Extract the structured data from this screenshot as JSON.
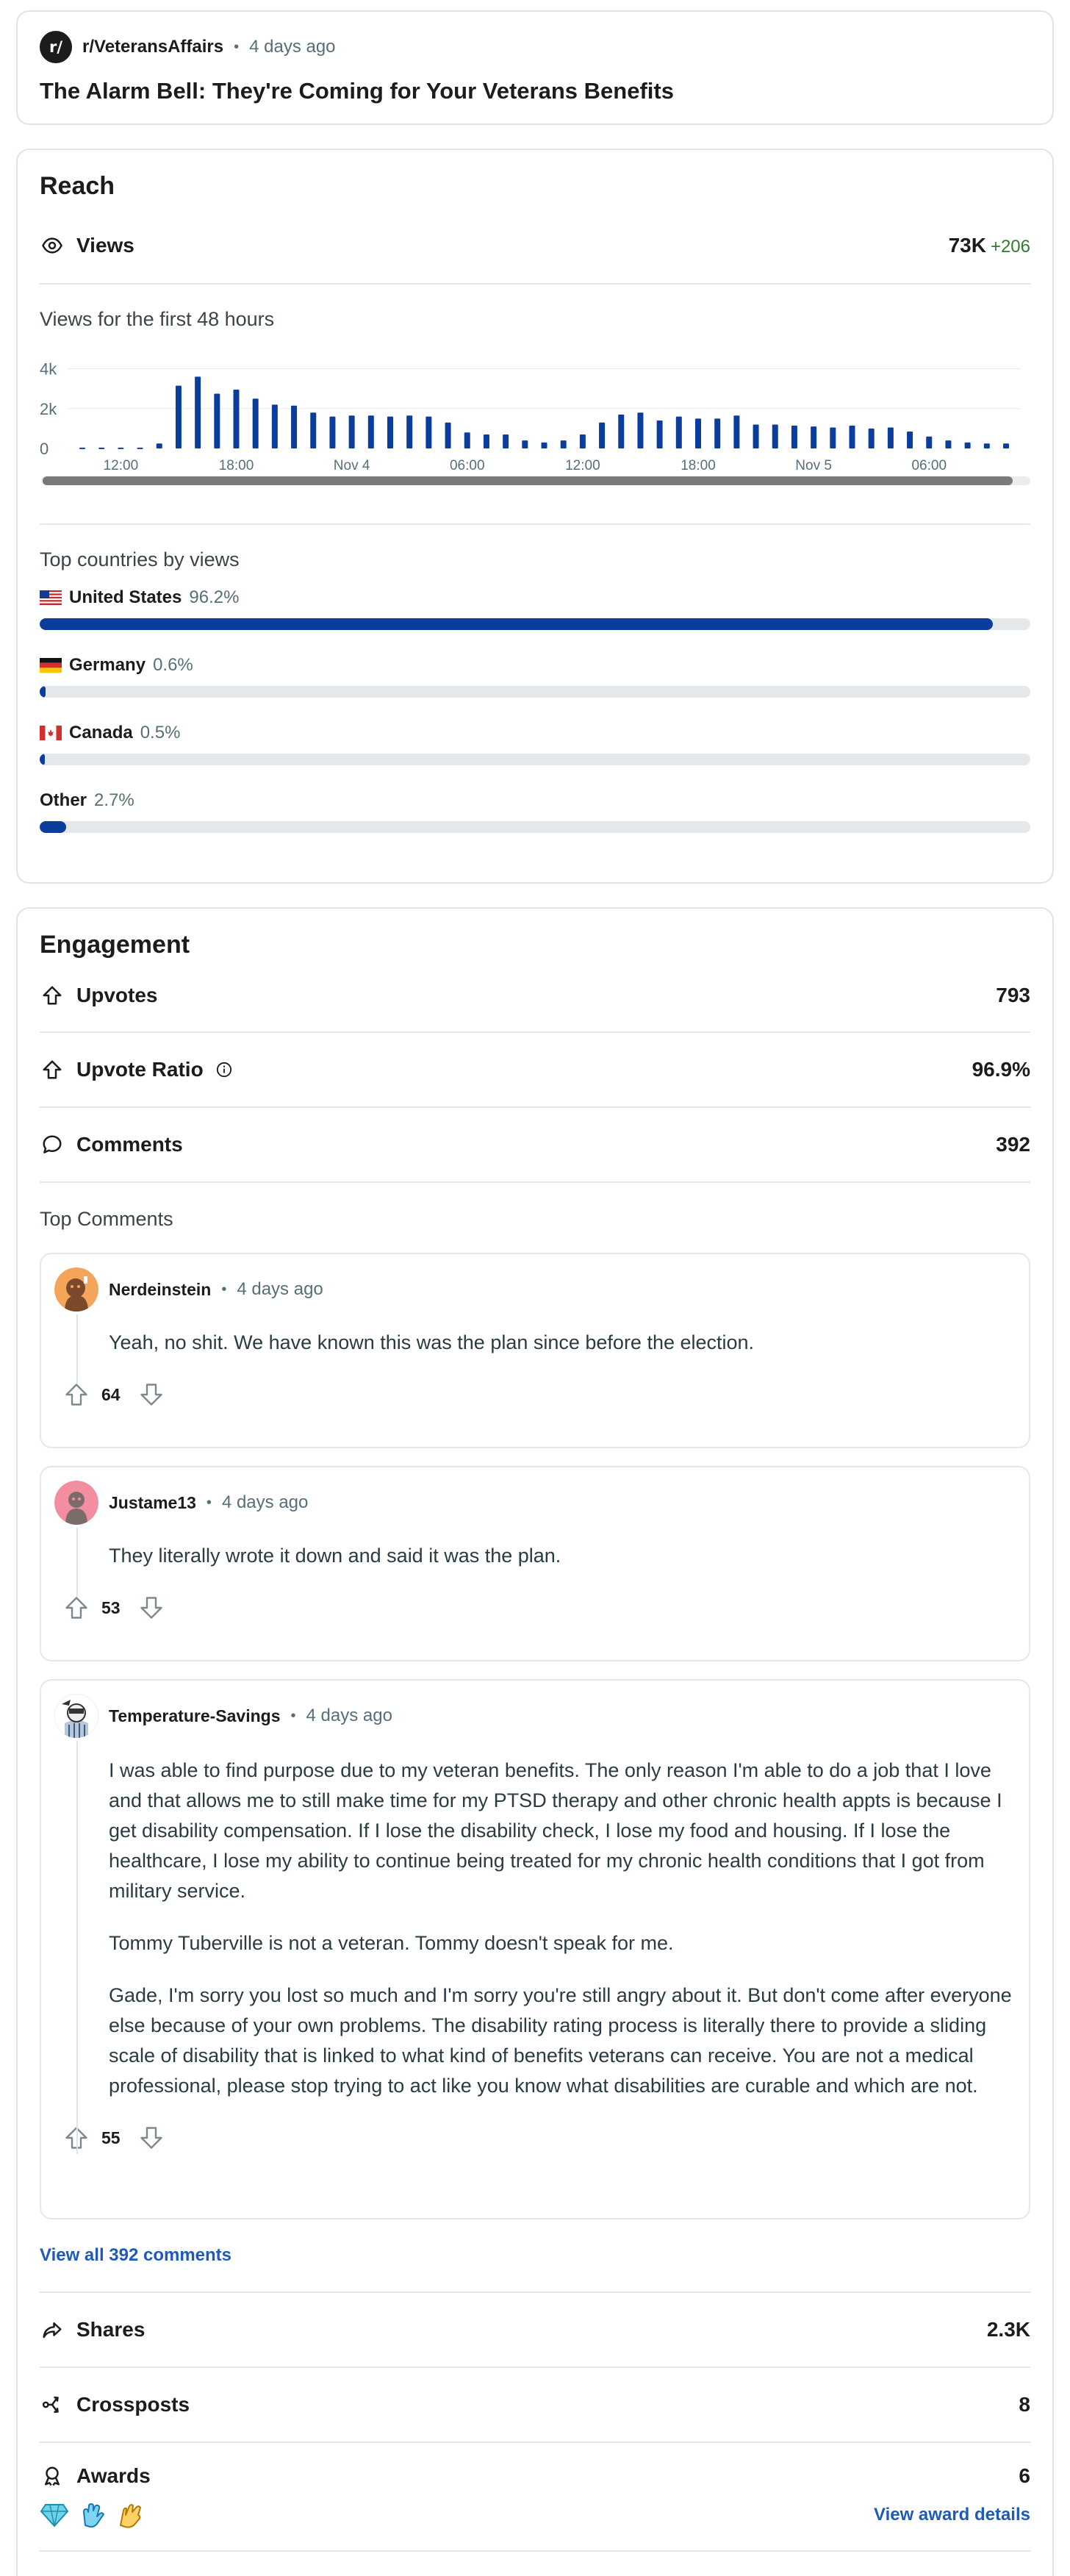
{
  "post": {
    "subreddit": "r/VeteransAffairs",
    "time_ago": "4 days ago",
    "title": "The Alarm Bell: They're Coming for Your Veterans Benefits",
    "avatar_text": "r/"
  },
  "reach": {
    "title": "Reach",
    "views_label": "Views",
    "views_value": "73K",
    "views_delta": "+206",
    "chart_heading": "Views for the first 48 hours",
    "countries_heading": "Top countries by views",
    "countries": [
      {
        "name": "United States",
        "pct": "96.2%",
        "fraction": 0.962
      },
      {
        "name": "Germany",
        "pct": "0.6%",
        "fraction": 0.006
      },
      {
        "name": "Canada",
        "pct": "0.5%",
        "fraction": 0.005
      },
      {
        "name": "Other",
        "pct": "2.7%",
        "fraction": 0.027
      }
    ]
  },
  "chart_data": {
    "type": "bar",
    "title": "Views for the first 48 hours",
    "xlabel": "",
    "ylabel": "",
    "ylim": [
      0,
      4500
    ],
    "y_ticks": [
      "0",
      "2k",
      "4k"
    ],
    "y_tick_values": [
      0,
      2000,
      4000
    ],
    "x_tick_labels": [
      "12:00",
      "18:00",
      "Nov 4",
      "06:00",
      "12:00",
      "18:00",
      "Nov 5",
      "06:00"
    ],
    "x_tick_bar_index": [
      2,
      8,
      14,
      20,
      26,
      32,
      38,
      44
    ],
    "grid": true,
    "bar_color": "#0b3e9c",
    "values": [
      40,
      40,
      40,
      40,
      250,
      3150,
      3600,
      2750,
      2950,
      2500,
      2200,
      2150,
      1800,
      1600,
      1650,
      1650,
      1600,
      1650,
      1600,
      1300,
      800,
      700,
      700,
      400,
      300,
      400,
      700,
      1300,
      1700,
      1800,
      1400,
      1600,
      1500,
      1500,
      1650,
      1200,
      1200,
      1150,
      1100,
      1050,
      1150,
      1000,
      1050,
      850,
      600,
      400,
      300,
      250,
      250
    ]
  },
  "engagement": {
    "title": "Engagement",
    "upvotes_label": "Upvotes",
    "upvotes_value": "793",
    "ratio_label": "Upvote Ratio",
    "ratio_value": "96.9%",
    "comments_label": "Comments",
    "comments_value": "392",
    "top_comments_heading": "Top Comments",
    "view_all": "View all 392 comments",
    "shares_label": "Shares",
    "shares_value": "2.3K",
    "crossposts_label": "Crossposts",
    "crossposts_value": "8",
    "awards_label": "Awards",
    "awards_value": "6",
    "award_details": "View award details"
  },
  "comments": [
    {
      "user": "Nerdeinstein",
      "time_ago": "4 days ago",
      "paragraphs": [
        "Yeah, no shit. We have known this was the plan since before the election."
      ],
      "score": "64"
    },
    {
      "user": "Justame13",
      "time_ago": "4 days ago",
      "paragraphs": [
        "They literally wrote it down and said it was the plan."
      ],
      "score": "53"
    },
    {
      "user": "Temperature-Savings",
      "time_ago": "4 days ago",
      "paragraphs": [
        "I was able to find purpose due to my veteran benefits. The only reason I'm able to do a job that I love and that allows me to still make time for my PTSD therapy and other chronic health appts is because I get disability compensation. If I lose the disability check, I lose my food and housing. If I lose the healthcare, I lose my ability to continue being treated for my chronic health conditions that I got from military service.",
        "Tommy Tuberville is not a veteran. Tommy doesn't speak for me.",
        "Gade, I'm sorry you lost so much and I'm sorry you're still angry about it. But don't come after everyone else because of your own problems. The disability rating process is literally there to provide a sliding scale of disability that is linked to what kind of benefits veterans can receive. You are not a medical professional, please stop trying to act like you know what disabilities are curable and which are not."
      ],
      "score": "55"
    }
  ],
  "icons": {
    "views": "eye-icon",
    "upvotes": "upvote-arrow-icon",
    "ratio": "upvote-arrow-icon",
    "info": "info-icon",
    "comments": "comment-bubble-icon",
    "shares": "share-arrow-icon",
    "crossposts": "crosspost-icon",
    "awards": "award-ribbon-icon"
  }
}
